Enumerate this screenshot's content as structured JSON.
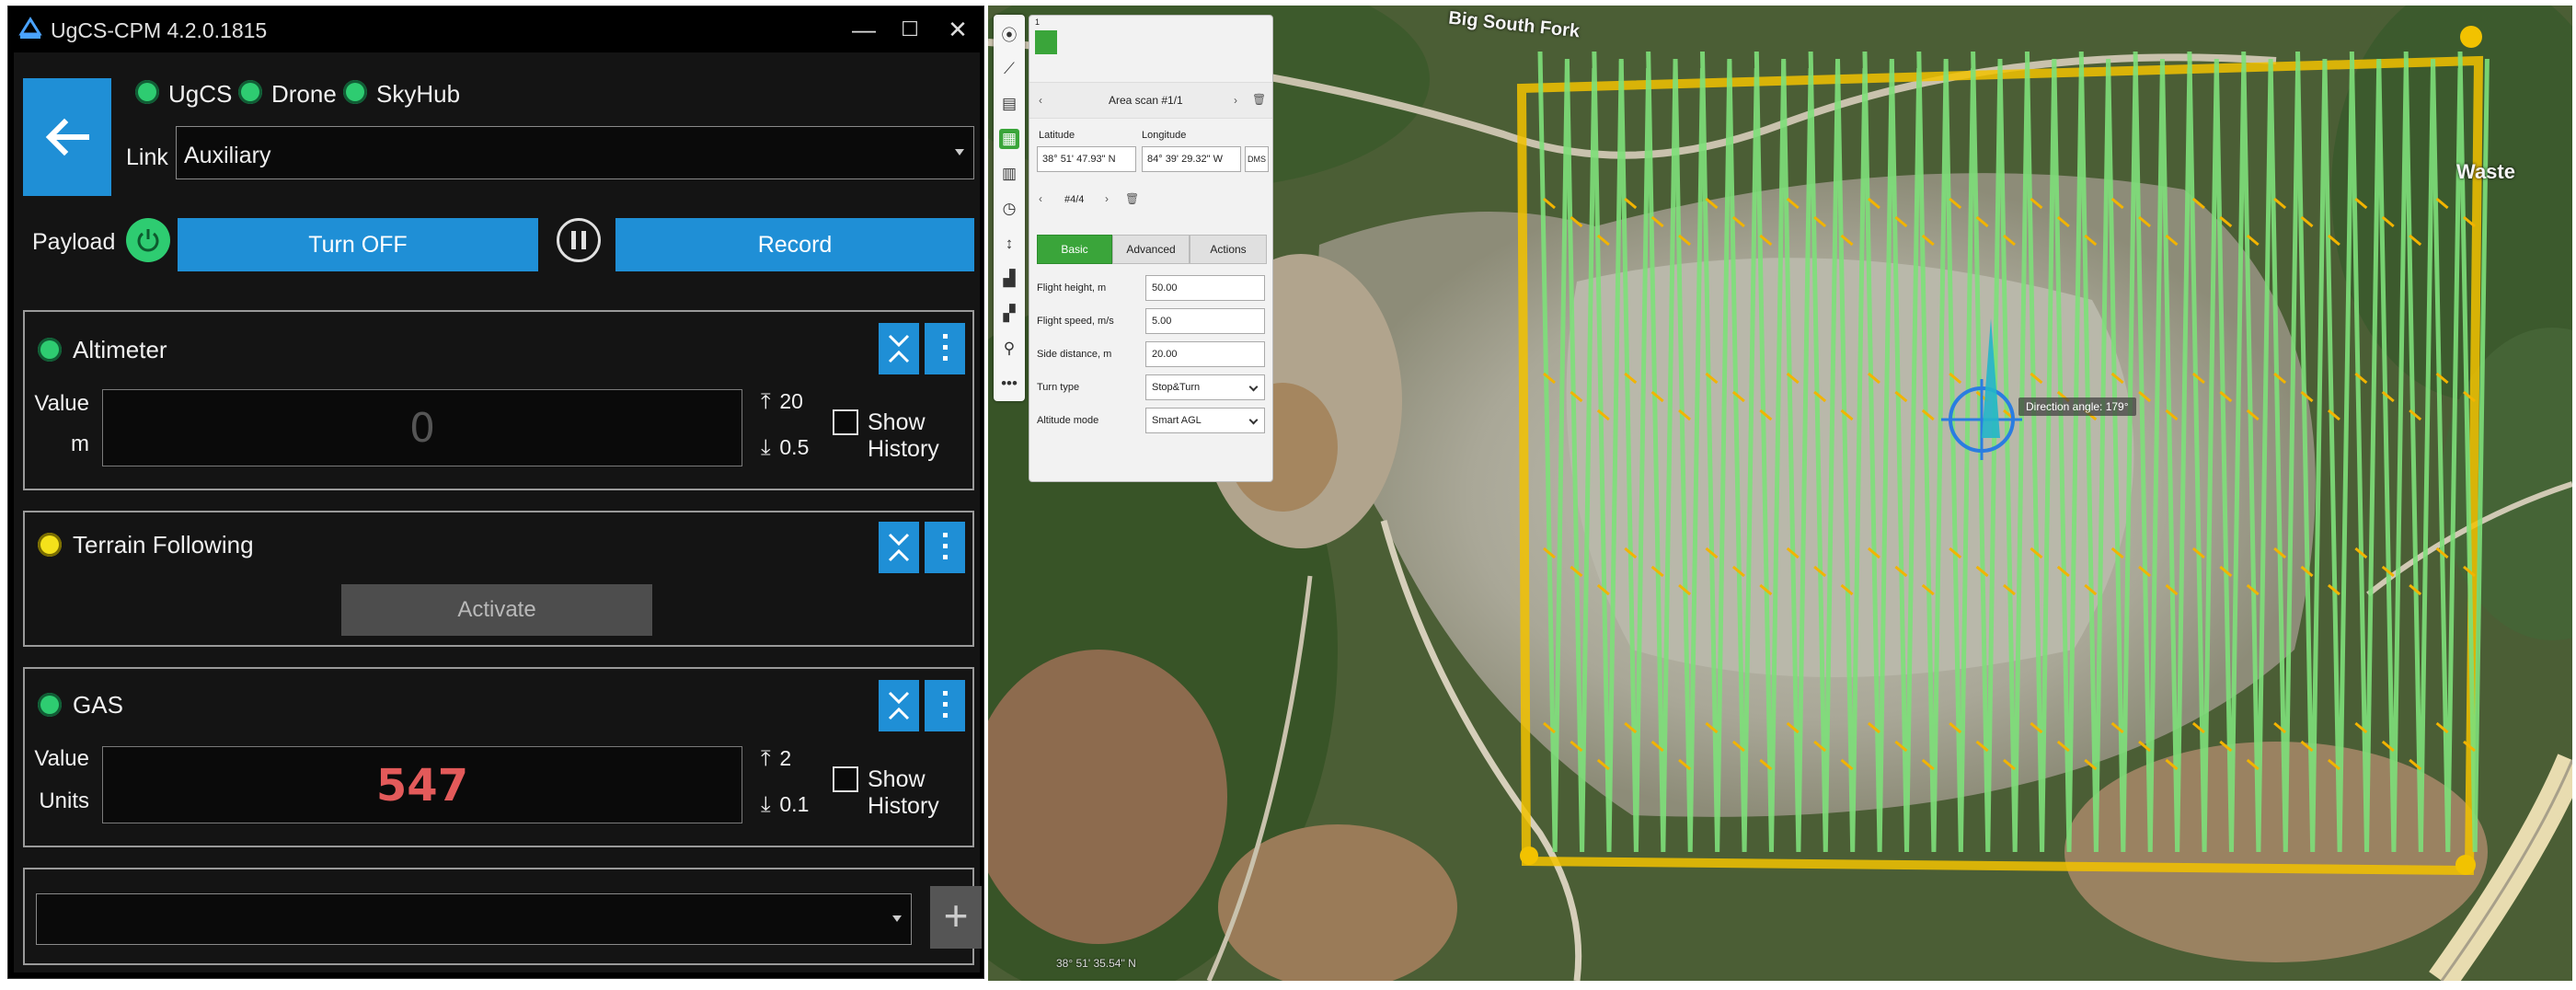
{
  "window": {
    "title": "UgCS-CPM 4.2.0.1815",
    "minimize": "—",
    "maximize": "☐",
    "close": "✕"
  },
  "status": {
    "ugcs": "UgCS",
    "drone": "Drone",
    "skyhub": "SkyHub"
  },
  "link": {
    "label": "Link",
    "value": "Auxiliary"
  },
  "payload": {
    "label": "Payload",
    "turn_off": "Turn OFF",
    "record": "Record"
  },
  "altimeter": {
    "title": "Altimeter",
    "value_label": "Value",
    "unit_label": "m",
    "value": "0",
    "max": "20",
    "min": "0.5",
    "show_history": "Show History"
  },
  "terrain": {
    "title": "Terrain Following",
    "activate": "Activate"
  },
  "gas": {
    "title": "GAS",
    "value_label": "Value",
    "unit_label": "Units",
    "value": "547",
    "max": "2",
    "min": "0.1",
    "show_history": "Show History"
  },
  "bottom": {
    "add": "+"
  },
  "map": {
    "labels": {
      "road": "Big South Fork",
      "waste": "Waste"
    },
    "direction_label": "Direction angle: 179°",
    "coord_readout": "38° 51' 35.54\" N",
    "panel": {
      "page": "1",
      "route_name": "Area scan #1/1",
      "latitude_label": "Latitude",
      "longitude_label": "Longitude",
      "latitude": "38° 51' 47.93\" N",
      "longitude": "84° 39' 29.32\" W",
      "dms": "DMS",
      "waypoint": "#4/4",
      "tabs": [
        "Basic",
        "Advanced",
        "Actions"
      ],
      "params": [
        {
          "label": "Flight height, m",
          "value": "50.00"
        },
        {
          "label": "Flight speed, m/s",
          "value": "5.00"
        },
        {
          "label": "Side distance, m",
          "value": "20.00"
        },
        {
          "label": "Turn type",
          "value": "Stop&Turn"
        },
        {
          "label": "Altitude mode",
          "value": "Smart AGL"
        }
      ]
    }
  },
  "colors": {
    "accent_blue": "#1f8fd6",
    "status_green": "#2ecc71",
    "status_yellow": "#f4e11b",
    "gas_value": "#e35a5a",
    "flight_path": "#7ee07a",
    "boundary": "#f2c200"
  }
}
